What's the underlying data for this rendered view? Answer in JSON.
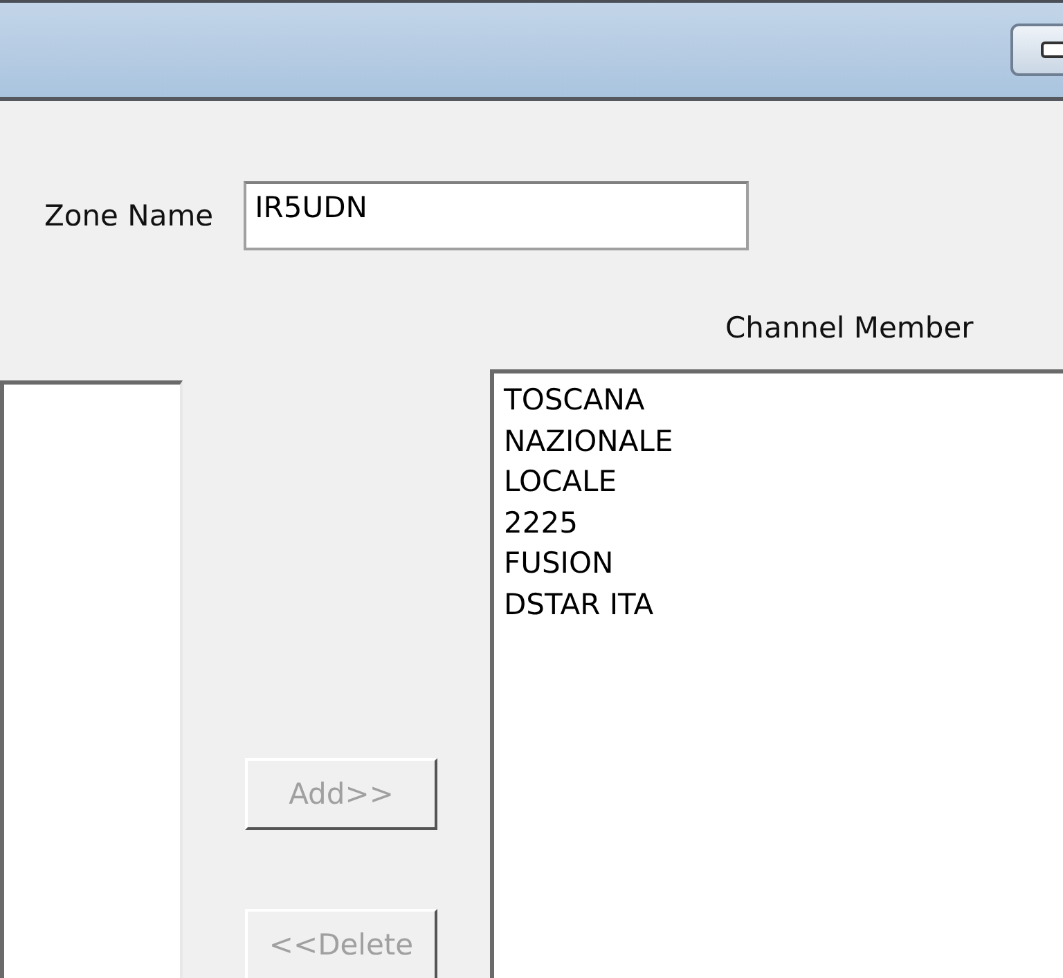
{
  "zone_name": {
    "label": "Zone Name",
    "value": "IR5UDN"
  },
  "channel_member": {
    "label": "Channel Member",
    "items": [
      "TOSCANA",
      "NAZIONALE",
      "LOCALE",
      "2225",
      "FUSION",
      "DSTAR ITA"
    ]
  },
  "buttons": [
    {
      "label": "Add>>",
      "disabled": true
    },
    {
      "label": "<<Delete",
      "disabled": true
    }
  ]
}
